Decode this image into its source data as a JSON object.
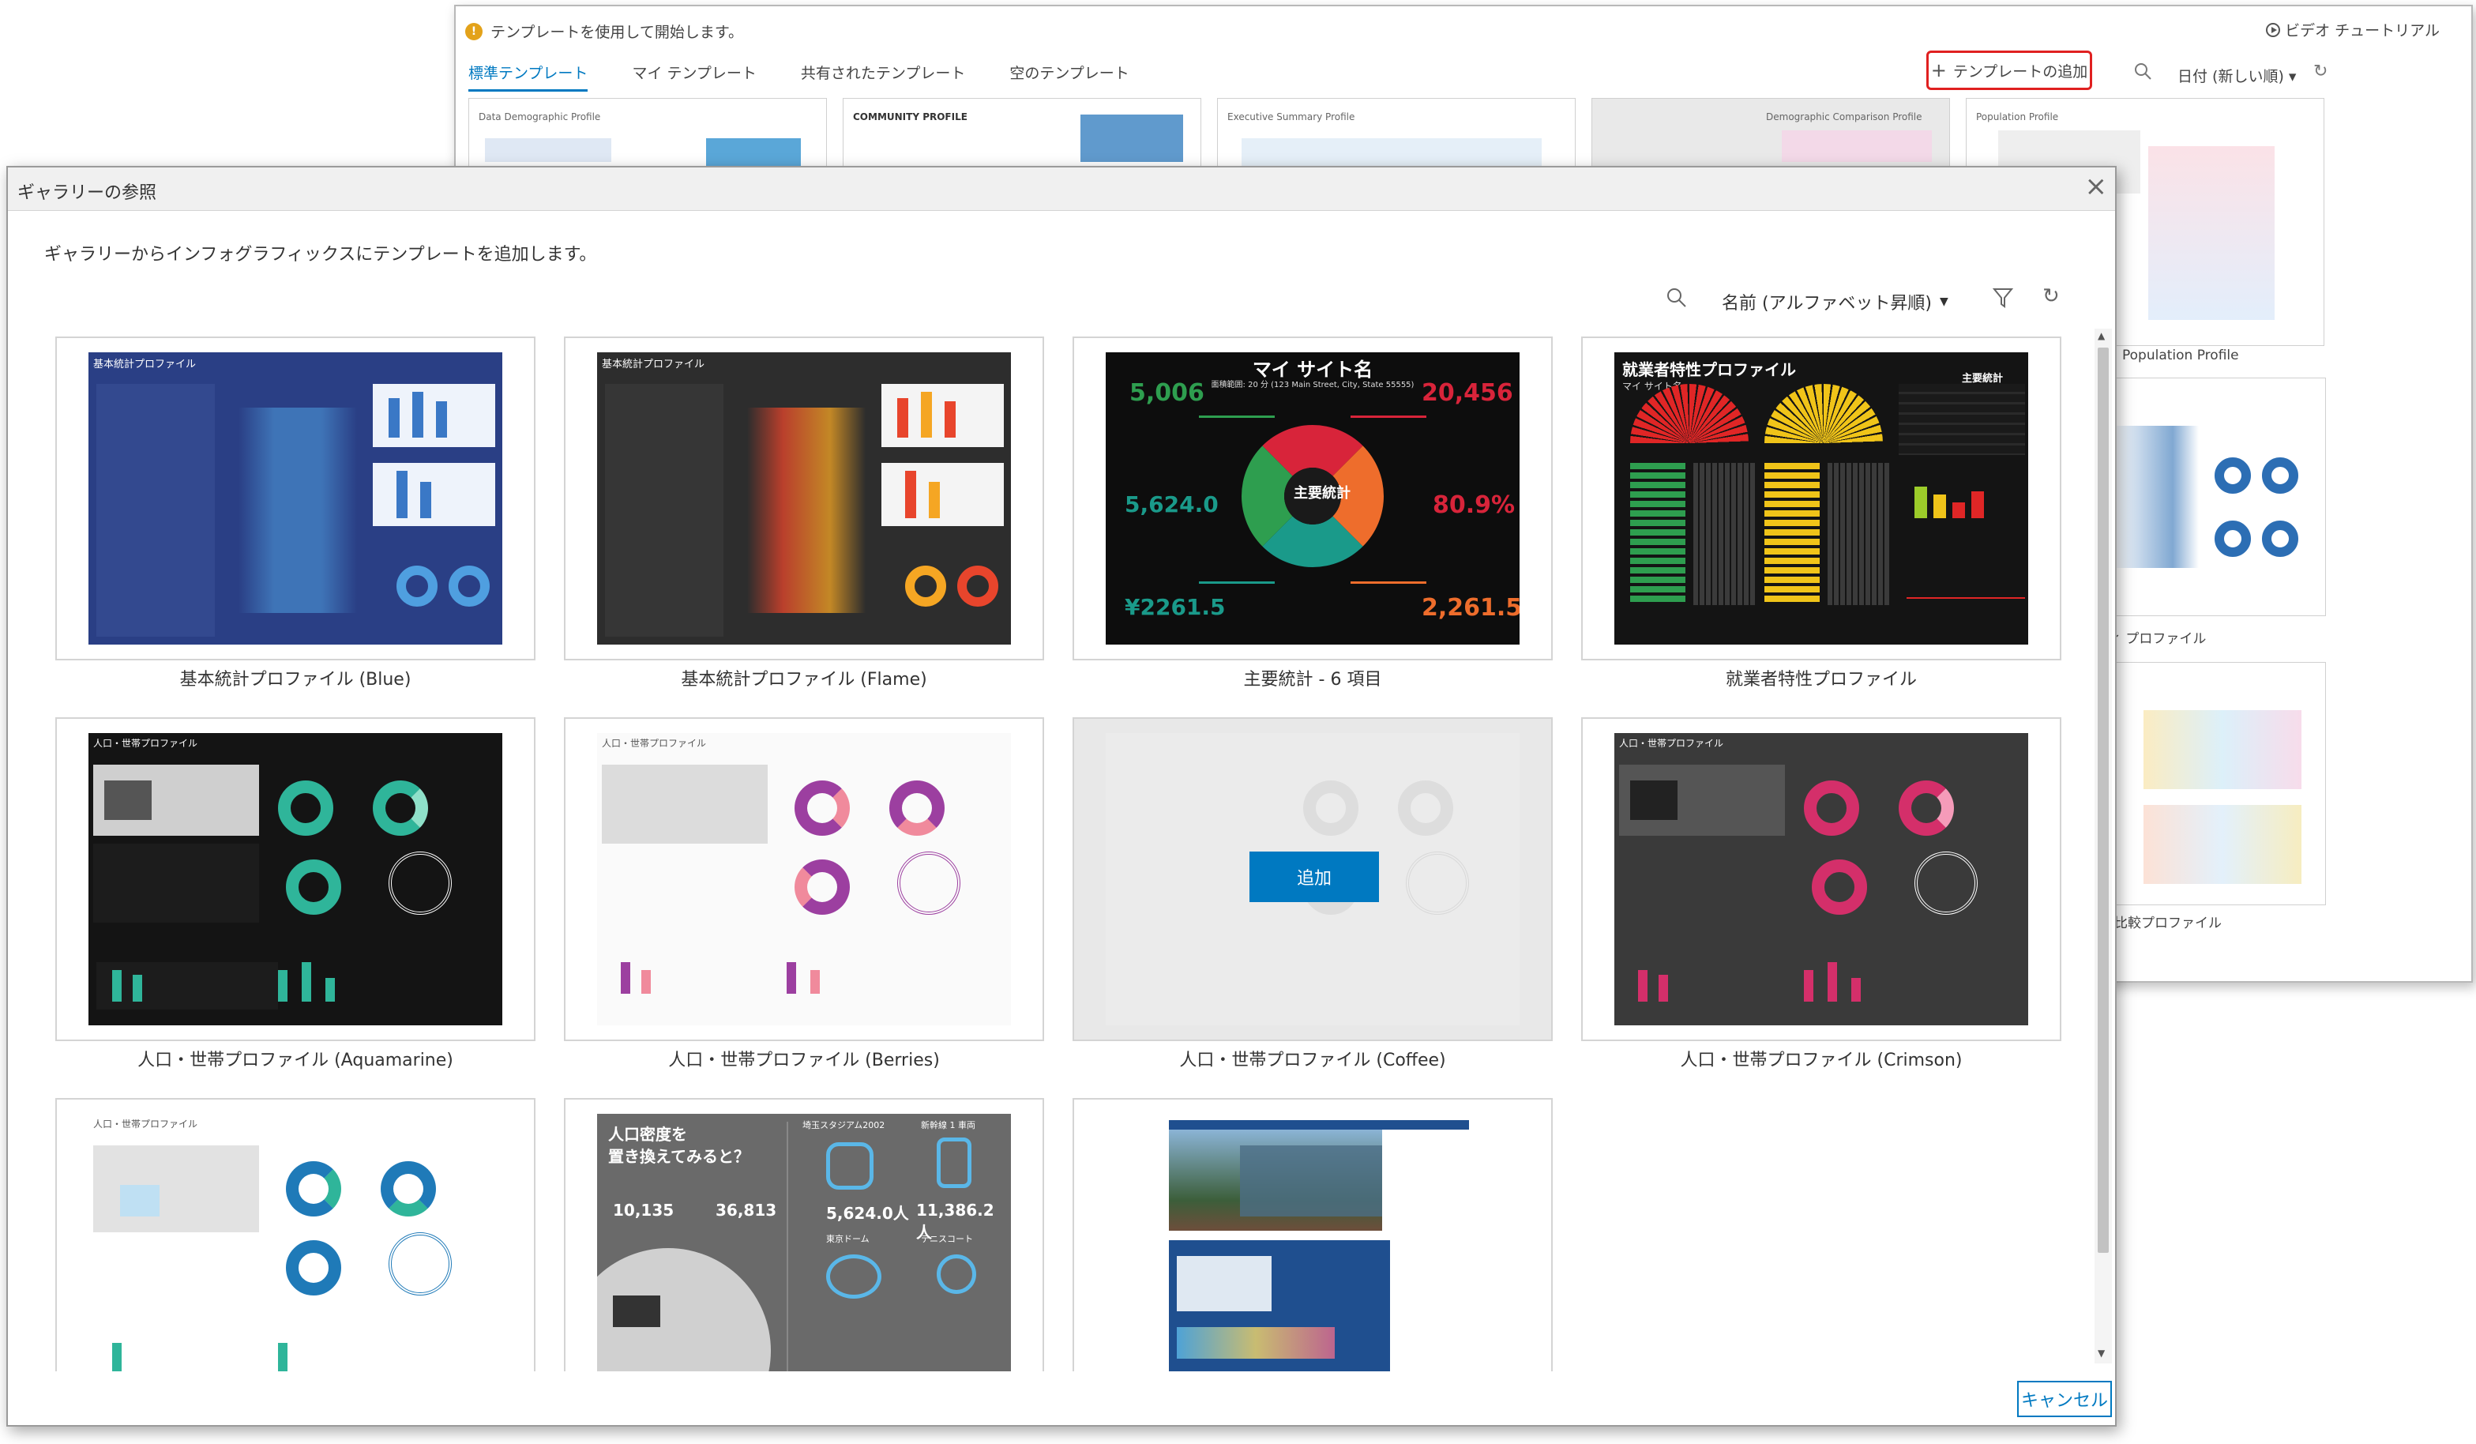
{
  "background_window": {
    "hint": "テンプレートを使用して開始します。",
    "hint_badge": "!",
    "video_tutorial": "ビデオ チュートリアル",
    "tabs": [
      "標準テンプレート",
      "マイ テンプレート",
      "共有されたテンプレート",
      "空のテンプレート"
    ],
    "add_template": "テンプレートの追加",
    "sort": "日付 (新しい順)",
    "thumbs": [
      "Data Demographic Profile",
      "COMMUNITY PROFILE",
      "Executive Summary Profile",
      "Demographic Comparison Profile",
      "Population Profile"
    ],
    "captions": [
      "Population Profile",
      "ティ プロファイル",
      "比較プロファイル"
    ]
  },
  "dialog": {
    "title": "ギャラリーの参照",
    "description": "ギャラリーからインフォグラフィックスにテンプレートを追加します。",
    "sort": "名前 (アルファベット昇順)",
    "add_button": "追加",
    "cancel_button": "キャンセル",
    "cards": [
      {
        "label": "基本統計プロファイル (Blue)",
        "theme": "blue"
      },
      {
        "label": "基本統計プロファイル (Flame)",
        "theme": "flame"
      },
      {
        "label": "主要統計 - 6 項目",
        "theme": "six"
      },
      {
        "label": "就業者特性プロファイル",
        "theme": "employee"
      },
      {
        "label": "人口・世帯プロファイル (Aquamarine)",
        "theme": "aqua"
      },
      {
        "label": "人口・世帯プロファイル (Berries)",
        "theme": "berries"
      },
      {
        "label": "人口・世帯プロファイル (Coffee)",
        "theme": "coffee"
      },
      {
        "label": "人口・世帯プロファイル (Crimson)",
        "theme": "crimson"
      },
      {
        "label": "",
        "theme": "teal-light"
      },
      {
        "label": "",
        "theme": "gray"
      },
      {
        "label": "",
        "theme": "photo"
      }
    ],
    "thumb_text": {
      "blue_title": "基本統計プロファイル",
      "six_title": "マイ サイト名",
      "six_subtitle": "面積範囲: 20 分 (123 Main Street, City, State 55555)",
      "six_center": "主要統計",
      "six_v1": "5,006",
      "six_v2": "20,456",
      "six_v3": "5,624.0",
      "six_v4": "80.9%",
      "six_v5": "¥2261.5",
      "six_v6": "2,261.5",
      "emp_title": "就業者特性プロファイル",
      "emp_sub": "マイ サイト名",
      "emp_right": "主要統計",
      "aqua_title": "人口・世帯プロファイル",
      "gray_title1": "人口密度を",
      "gray_title2": "置き換えてみると？",
      "gray_n1": "10,135",
      "gray_n2": "36,813",
      "gray_n3": "5,624.0人",
      "gray_n4": "11,386.2 人",
      "gray_l1": "埼玉スタジアム2002",
      "gray_l2": "新幹線 1 車両",
      "gray_l3": "東京ドーム",
      "gray_l4": "テニスコート"
    },
    "colors": {
      "accent": "#0079c1",
      "blue_bg": "#2a3f85",
      "flame": "#e8452c",
      "six_green": "#2e9e4f",
      "six_red": "#d8243a",
      "six_orange": "#ee6d2c",
      "six_teal": "#1a9a8a",
      "aqua": "#2fb59a",
      "berries": "#9c3fa0",
      "crimson": "#d42f6a"
    }
  }
}
